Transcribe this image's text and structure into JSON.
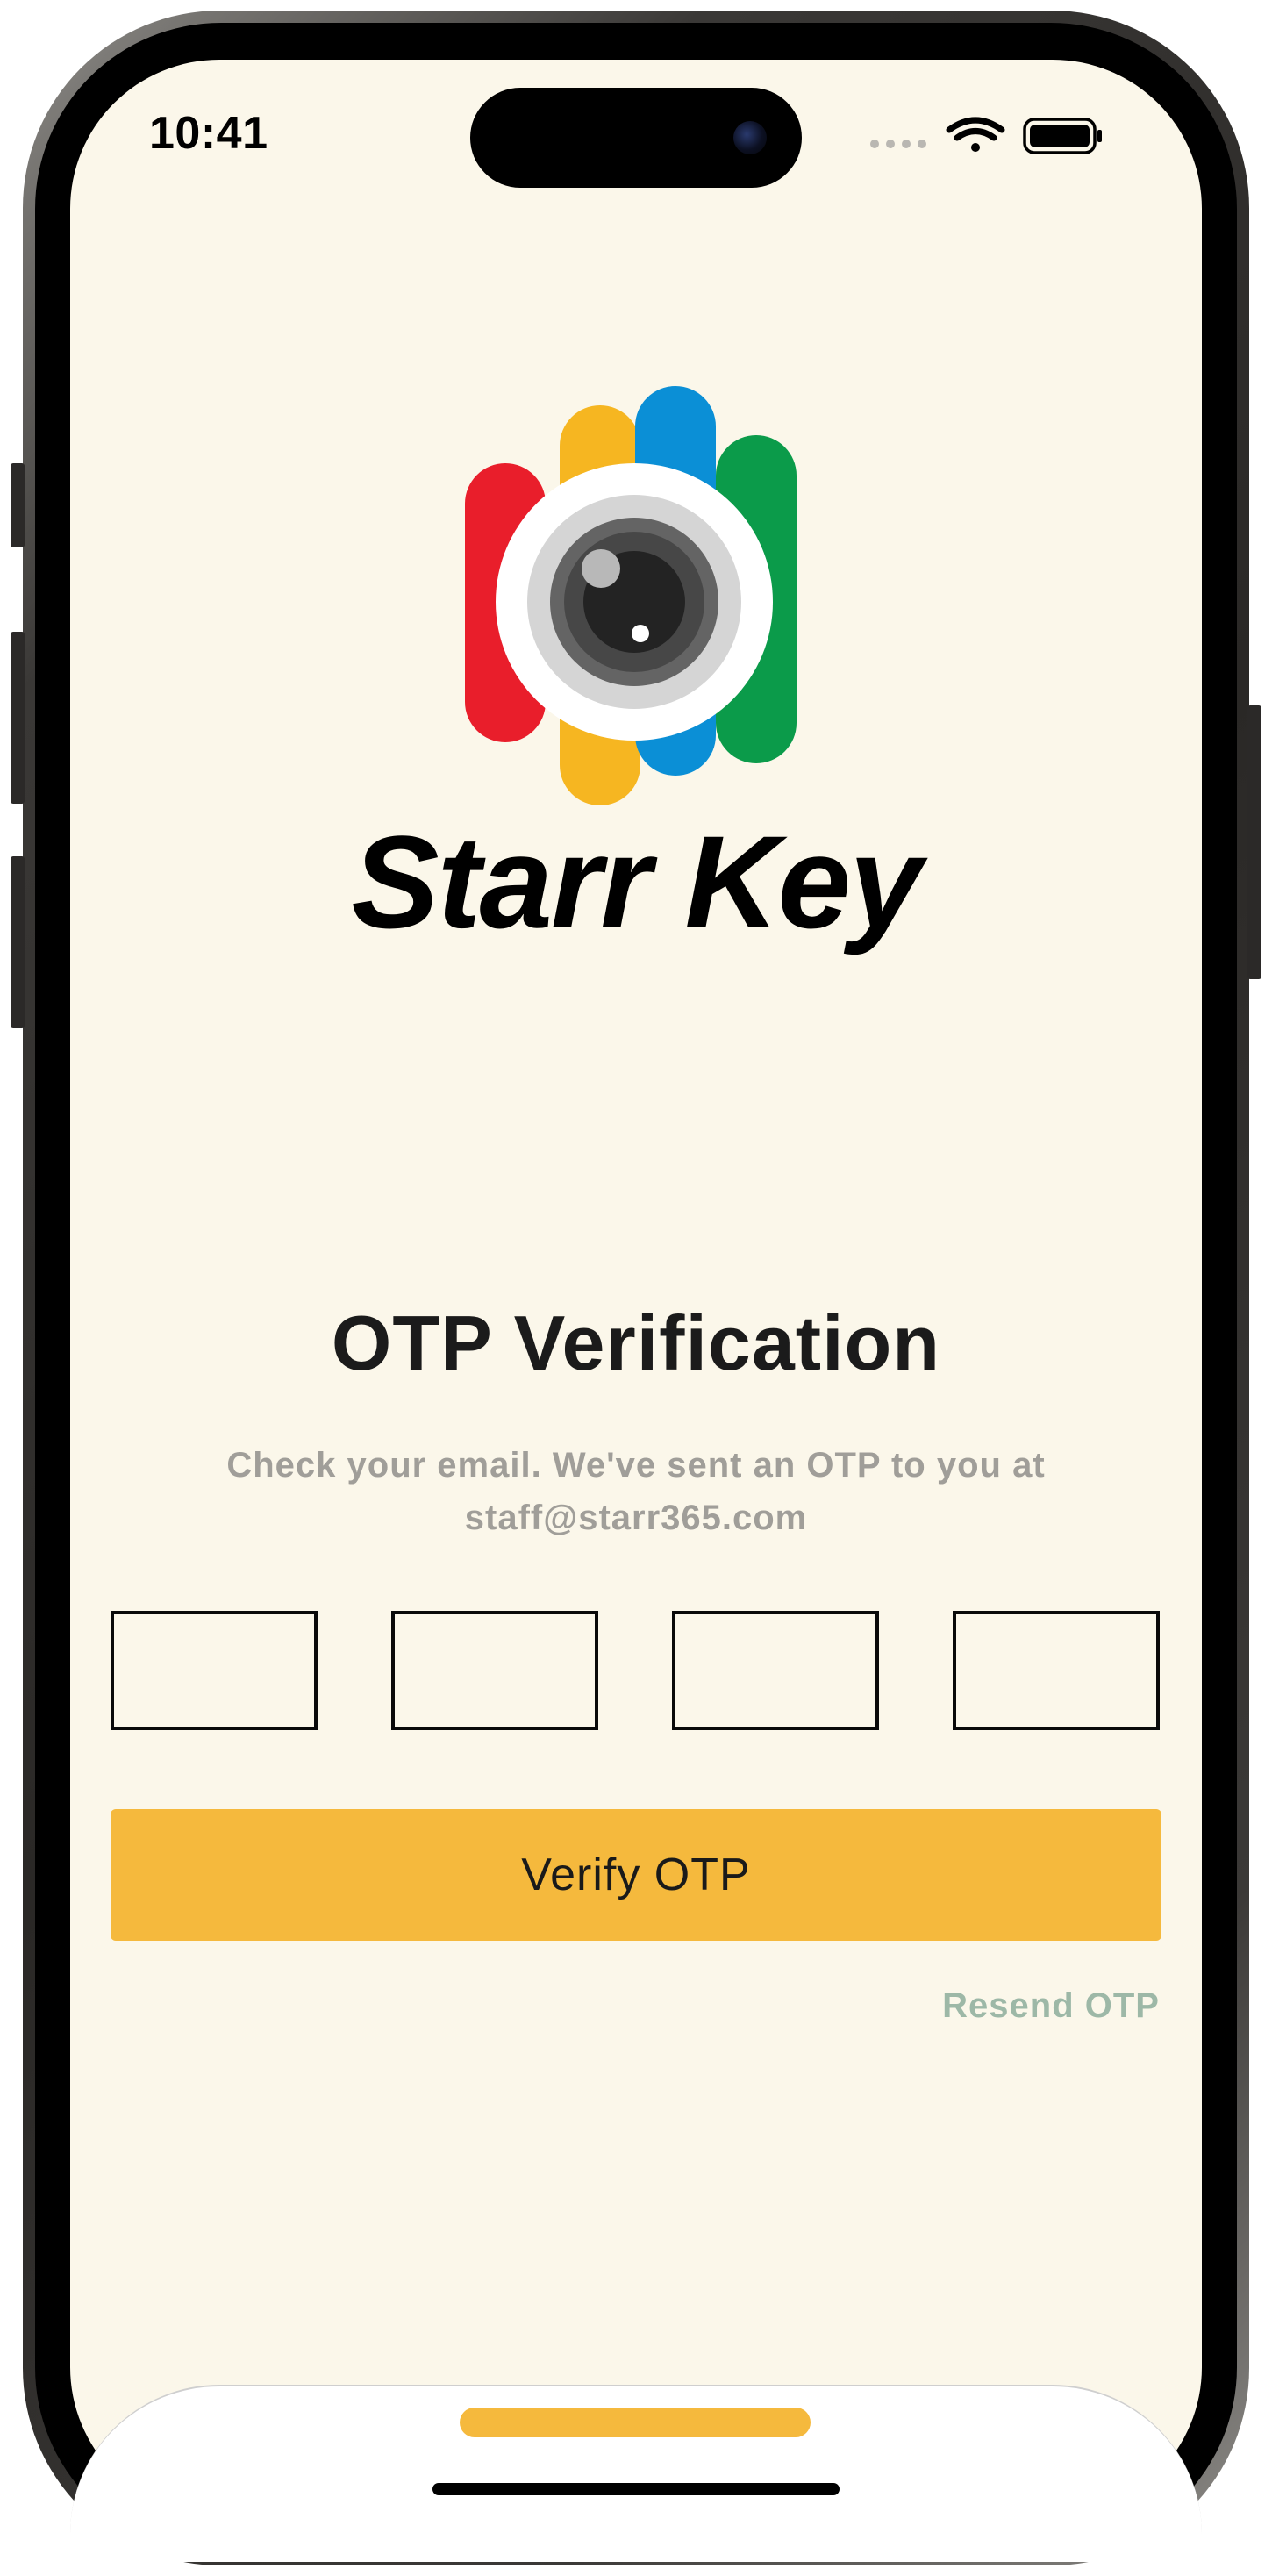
{
  "status_bar": {
    "time": "10:41"
  },
  "brand": {
    "name": "Starr Key",
    "colors": [
      "#e91e2b",
      "#f6b621",
      "#0b8fd6",
      "#0b9b4a"
    ]
  },
  "screen": {
    "title": "OTP Verification",
    "subtitle_line1": "Check your email. We've sent an OTP to you at",
    "email": "staff@starr365.com"
  },
  "otp": {
    "digits": [
      "",
      "",
      "",
      ""
    ]
  },
  "actions": {
    "verify_label": "Verify OTP",
    "resend_label": "Resend OTP"
  },
  "colors": {
    "background": "#fbf7ea",
    "accent": "#f5b93d",
    "link": "#9db8a7",
    "subtitle": "#a09e99"
  }
}
